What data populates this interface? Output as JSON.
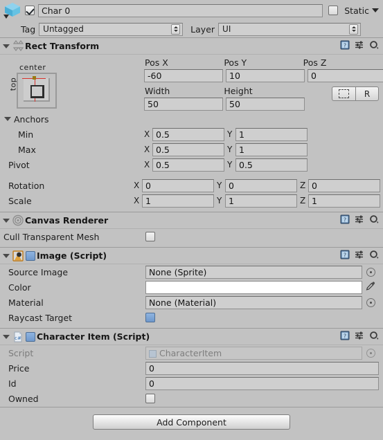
{
  "object_header": {
    "icon": "gameobject-cube-icon",
    "enabled": true,
    "name": "Char 0",
    "static_label": "Static",
    "static_checked": false,
    "tag_label": "Tag",
    "tag_value": "Untagged",
    "layer_label": "Layer",
    "layer_value": "UI"
  },
  "components": [
    {
      "id": "rect-transform",
      "title": "Rect Transform",
      "icon": "rect-transform-icon",
      "expanded": true,
      "anchor_preset": {
        "top_label": "center",
        "side_label": "top"
      },
      "pos_labels": [
        "Pos X",
        "Pos Y",
        "Pos Z"
      ],
      "pos_values": [
        "-60",
        "10",
        "0"
      ],
      "size_labels": [
        "Width",
        "Height"
      ],
      "size_values": [
        "50",
        "50"
      ],
      "blueprint_button": "blueprint-icon",
      "raw_button": "R",
      "anchors_label": "Anchors",
      "anchor_rows": [
        {
          "name": "Min",
          "indent": true,
          "axes": [
            "X",
            "Y"
          ],
          "values": [
            "0.5",
            "1"
          ]
        },
        {
          "name": "Max",
          "indent": true,
          "axes": [
            "X",
            "Y"
          ],
          "values": [
            "0.5",
            "1"
          ]
        },
        {
          "name": "Pivot",
          "indent": false,
          "axes": [
            "X",
            "Y"
          ],
          "values": [
            "0.5",
            "0.5"
          ]
        }
      ],
      "transform_rows": [
        {
          "name": "Rotation",
          "axes": [
            "X",
            "Y",
            "Z"
          ],
          "values": [
            "0",
            "0",
            "0"
          ]
        },
        {
          "name": "Scale",
          "axes": [
            "X",
            "Y",
            "Z"
          ],
          "values": [
            "1",
            "1",
            "1"
          ]
        }
      ]
    },
    {
      "id": "canvas-renderer",
      "title": "Canvas Renderer",
      "icon": "canvas-renderer-icon",
      "expanded": true,
      "rows": [
        {
          "label": "Cull Transparent Mesh",
          "type": "checkbox",
          "checked": false
        }
      ]
    },
    {
      "id": "image-script",
      "title": "Image (Script)",
      "icon": "image-component-icon",
      "expanded": true,
      "enabled": true,
      "rows": [
        {
          "label": "Source Image",
          "type": "object",
          "value": "None (Sprite)"
        },
        {
          "label": "Color",
          "type": "color",
          "value": "#FFFFFF"
        },
        {
          "label": "Material",
          "type": "object",
          "value": "None (Material)"
        },
        {
          "label": "Raycast Target",
          "type": "checkbox",
          "checked": true
        }
      ]
    },
    {
      "id": "character-item-script",
      "title": "Character Item (Script)",
      "icon": "csharp-script-icon",
      "expanded": true,
      "enabled": true,
      "rows": [
        {
          "label": "Script",
          "type": "script",
          "value": "CharacterItem",
          "disabled": true
        },
        {
          "label": "Price",
          "type": "text",
          "value": "0"
        },
        {
          "label": "Id",
          "type": "text",
          "value": "0"
        },
        {
          "label": "Owned",
          "type": "checkbox",
          "checked": false
        }
      ]
    }
  ],
  "header_icons": {
    "help": "help-book-icon",
    "preset": "preset-sliders-icon",
    "settings": "gear-icon"
  },
  "footer": {
    "add_component_label": "Add Component"
  },
  "colors": {
    "window_bg": "#c2c2c2",
    "field_bg": "#cfcfcf",
    "accent_blue": "#6f98cc",
    "anchor_red": "#d8322b",
    "color_swatch": "#ffffff"
  }
}
